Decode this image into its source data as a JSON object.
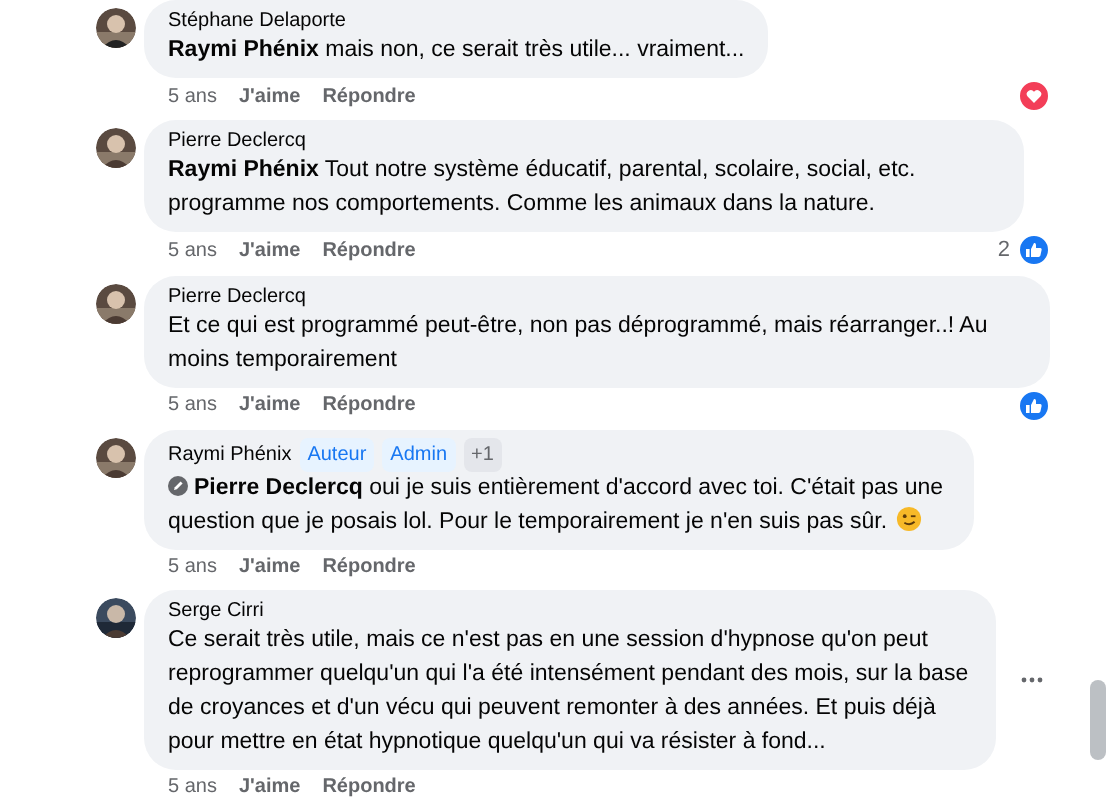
{
  "comments": [
    {
      "author": "Stéphane Delaporte",
      "text": "**Raymi Phénix** mais non, ce serait très utile... vraiment...",
      "time": "5 ans",
      "like": "J'aime",
      "reply": "Répondre",
      "reaction": {
        "kind": "heart"
      }
    },
    {
      "author": "Pierre Declercq",
      "text": "**Raymi Phénix** Tout notre système éducatif, parental, scolaire, social, etc. programme nos comportements. Comme les animaux dans la nature.",
      "time": "5 ans",
      "like": "J'aime",
      "reply": "Répondre",
      "reaction": {
        "kind": "like",
        "count": "2"
      }
    },
    {
      "author": "Pierre Declercq",
      "text": "Et ce qui est programmé peut-être, non pas déprogrammé, mais réarranger..! Au moins temporairement",
      "time": "5 ans",
      "like": "J'aime",
      "reply": "Répondre",
      "reaction": {
        "kind": "like"
      }
    },
    {
      "author": "Raymi Phénix",
      "badges": [
        {
          "label": "Auteur",
          "kind": "role"
        },
        {
          "label": "Admin",
          "kind": "role"
        },
        {
          "label": "+1",
          "kind": "more"
        }
      ],
      "mention": "Pierre Declercq",
      "text": "oui je suis entièrement d'accord avec toi. C'était pas une question que je posais lol. Pour le temporairement je n'en suis pas sûr.",
      "emoji": true,
      "time": "5 ans",
      "like": "J'aime",
      "reply": "Répondre"
    },
    {
      "author": "Serge Cirri",
      "text": "Ce serait très utile, mais ce n'est pas en une session d'hypnose qu'on peut reprogrammer quelqu'un qui l'a été intensément pendant des mois, sur la base de croyances et d'un vécu qui peuvent remonter à des années. Et puis déjà pour mettre en état hypnotique quelqu'un qui va résister à fond...",
      "time": "5 ans",
      "like": "J'aime",
      "reply": "Répondre",
      "options": true
    }
  ]
}
